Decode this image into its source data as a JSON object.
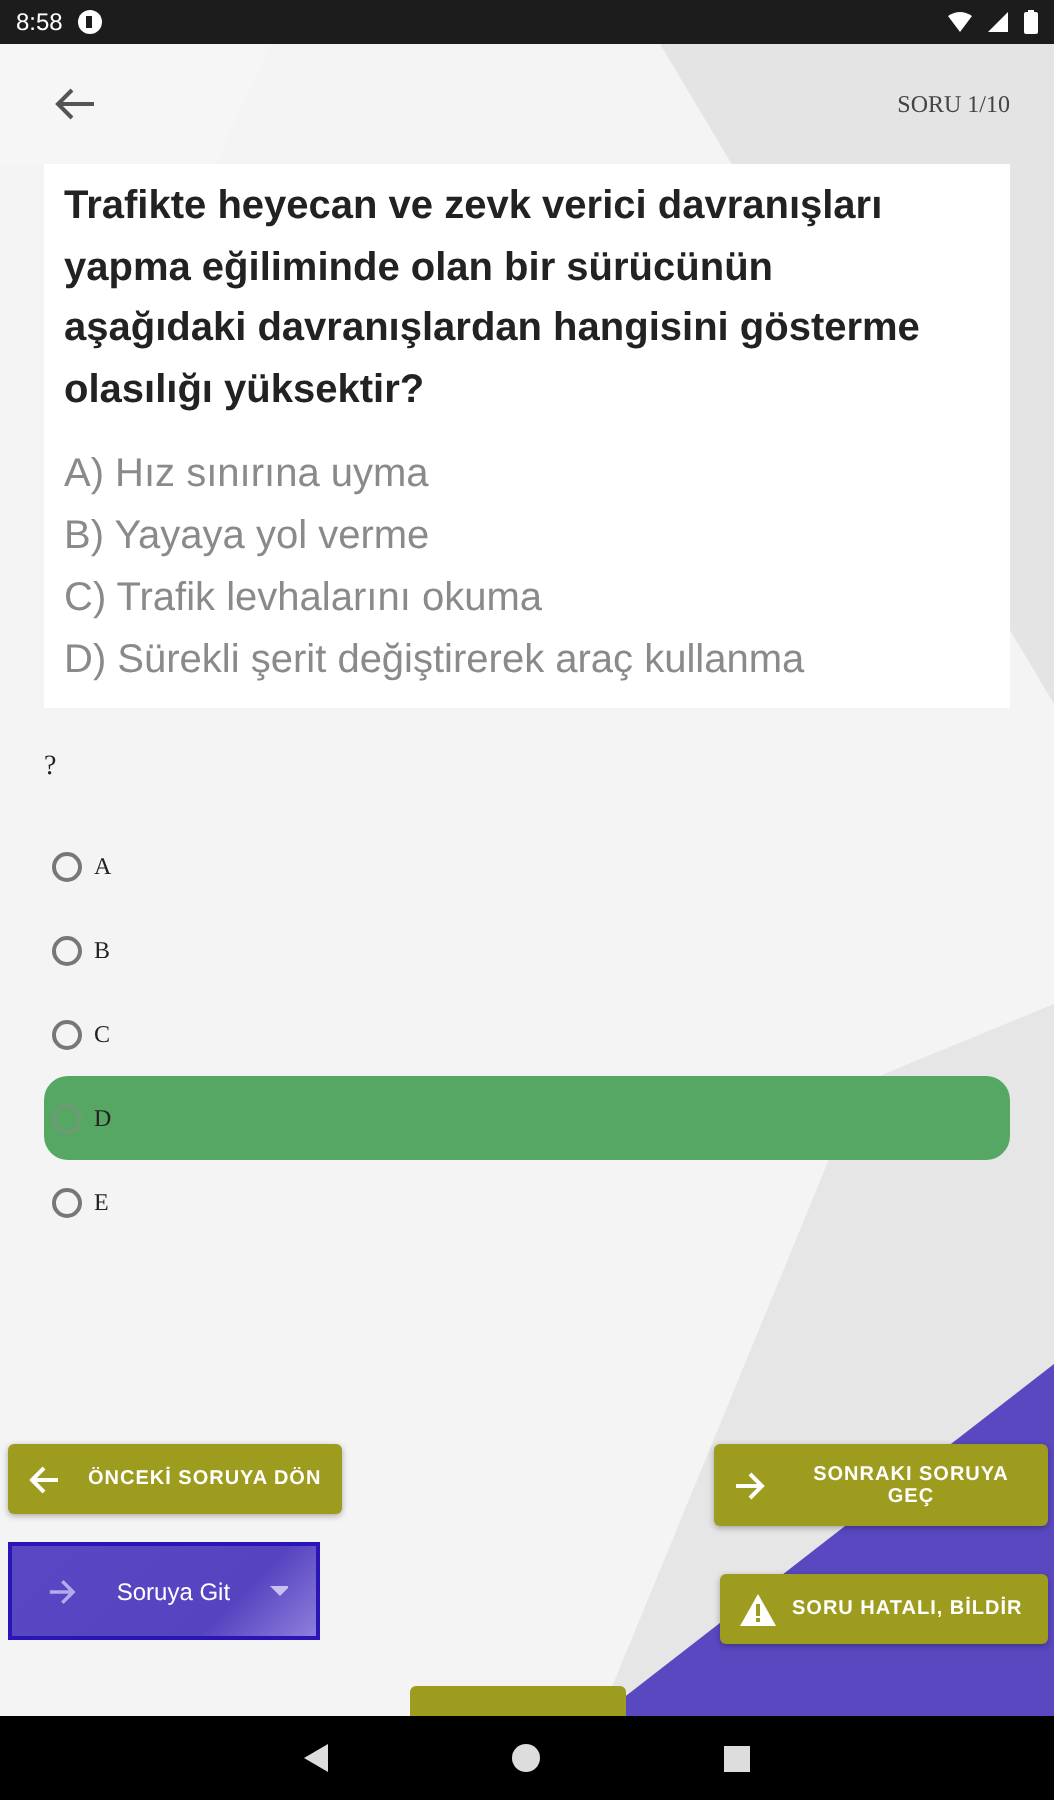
{
  "status_bar": {
    "time": "8:58"
  },
  "header": {
    "counter": "SORU 1/10"
  },
  "question": {
    "text": "Trafikte heyecan ve zevk verici davranışları yapma eğiliminde olan bir sürücünün aşağıdaki davranışlardan hangisini gösterme olasılığı yüksektir?",
    "choices": [
      "A) Hız sınırına uyma",
      "B) Yayaya yol verme",
      "C) Trafik levhalarını okuma",
      "D) Sürekli şerit değiştirerek araç kullanma"
    ]
  },
  "prompt": "?",
  "answers": [
    {
      "label": "A",
      "selected": false
    },
    {
      "label": "B",
      "selected": false
    },
    {
      "label": "C",
      "selected": false
    },
    {
      "label": "D",
      "selected": true
    },
    {
      "label": "E",
      "selected": false
    }
  ],
  "buttons": {
    "previous": "ÖNCEKİ SORUYA DÖN",
    "next": "SONRAKI SORUYA GEÇ",
    "goto": "Soruya Git",
    "report": "SORU HATALI, BİLDİR"
  }
}
